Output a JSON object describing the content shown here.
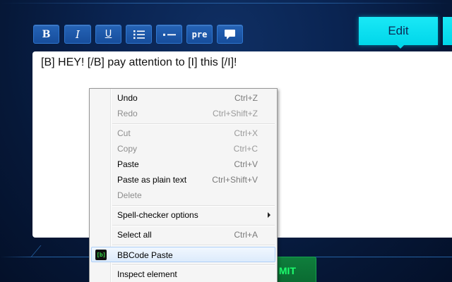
{
  "toolbar": {
    "bold_label": "B",
    "italic_label": "I",
    "underline_label": "U",
    "pre_label": "pre",
    "list_icon": "list-icon",
    "dash_icon": "horizontal-rule-icon",
    "quote_icon": "speech-bubble-icon"
  },
  "tabs": {
    "edit_label": "Edit"
  },
  "editor": {
    "content": "[B] HEY! [/B] pay attention to [I] this [/I]!"
  },
  "submit": {
    "visible_label": "MIT"
  },
  "context_menu": {
    "undo": {
      "label": "Undo",
      "shortcut": "Ctrl+Z"
    },
    "redo": {
      "label": "Redo",
      "shortcut": "Ctrl+Shift+Z"
    },
    "cut": {
      "label": "Cut",
      "shortcut": "Ctrl+X"
    },
    "copy": {
      "label": "Copy",
      "shortcut": "Ctrl+C"
    },
    "paste": {
      "label": "Paste",
      "shortcut": "Ctrl+V"
    },
    "paste_plain": {
      "label": "Paste as plain text",
      "shortcut": "Ctrl+Shift+V"
    },
    "delete": {
      "label": "Delete"
    },
    "spell": {
      "label": "Spell-checker options"
    },
    "select_all": {
      "label": "Select all",
      "shortcut": "Ctrl+A"
    },
    "bbcode_paste": {
      "label": "BBCode Paste",
      "icon_text": "[b]"
    },
    "inspect": {
      "label": "Inspect element"
    }
  },
  "colors": {
    "background": "#0a2452",
    "toolbar_button": "#1b56a6",
    "edit_tab": "#00d7ea",
    "submit_button": "#0a6a31",
    "submit_text": "#1dff6e",
    "menu_background": "#f5f5f5",
    "menu_highlight": "#dcebfc"
  }
}
